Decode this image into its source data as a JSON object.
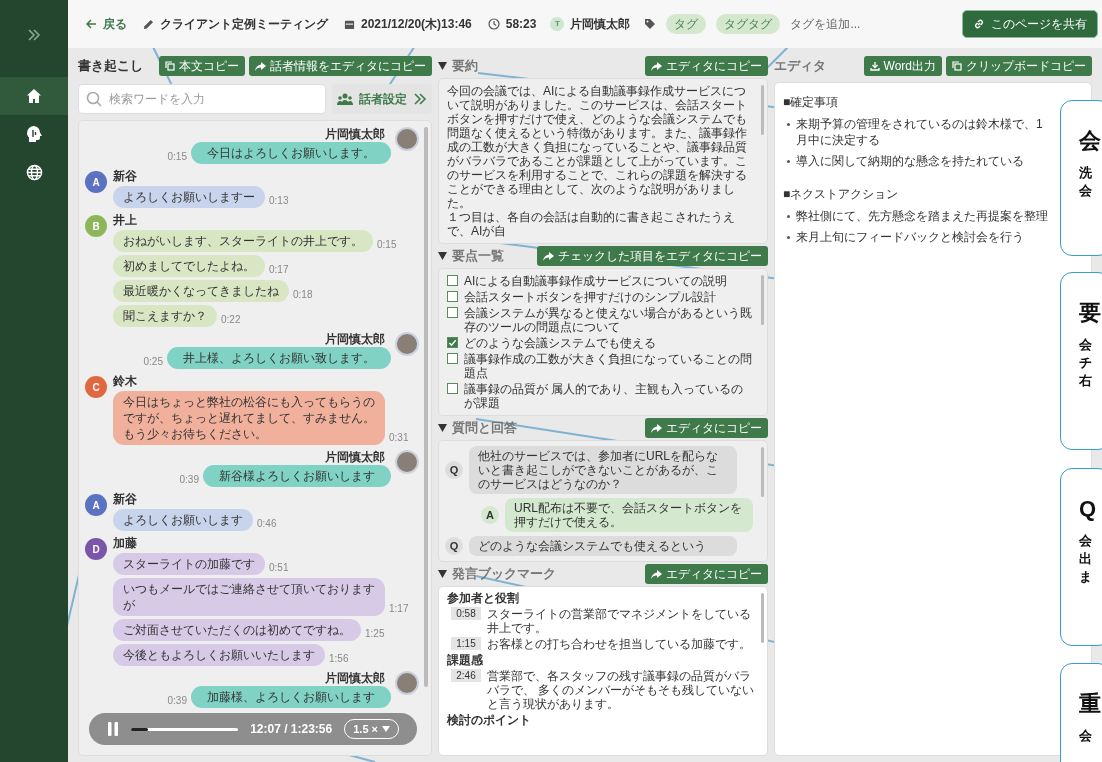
{
  "sidebar": {
    "nav_items": [
      {
        "selected": true
      },
      {
        "selected": false
      },
      {
        "selected": false
      }
    ]
  },
  "header": {
    "back": "戻る",
    "title": "クライアント定例ミーティング",
    "date": "2021/12/20(木)13:46",
    "duration": "58:23",
    "owner": {
      "initial": "T",
      "name": "片岡慎太郎"
    },
    "tags": [
      "タグ",
      "タグタグ"
    ],
    "add_tag": "タグを追加...",
    "share": "このページを共有"
  },
  "transcript": {
    "title": "書き起こし",
    "buttons": [
      "本文コピー",
      "話者情報をエディタにコピー"
    ],
    "search": {
      "placeholder": "検索ワードを入力"
    },
    "speaker_settings": "話者設定",
    "blocks": [
      {
        "kind": "self",
        "speaker": "片岡慎太郎",
        "messages": [
          {
            "text": "今日はよろしくお願いします。",
            "time": "0:15"
          }
        ]
      },
      {
        "kind": "other",
        "speaker": "新谷",
        "initial": "A",
        "color": "#5a72bf",
        "messages": [
          {
            "text": "よろしくお願いしますー",
            "time": "0:13"
          }
        ]
      },
      {
        "kind": "other",
        "speaker": "井上",
        "initial": "B",
        "color": "#8db65b",
        "messages": [
          {
            "text": "おねがいします、スターライトの井上です。",
            "time": "0:15"
          },
          {
            "text": "初めましてでしたよね。",
            "time": "0:17"
          },
          {
            "text": "最近暖かくなってきましたね",
            "time": "0:18"
          },
          {
            "text": "聞こえますか？",
            "time": "0:22"
          }
        ]
      },
      {
        "kind": "self",
        "speaker": "片岡慎太郎",
        "messages": [
          {
            "text": "井上様、よろしくお願い致します。",
            "time": "0:25"
          }
        ]
      },
      {
        "kind": "other",
        "speaker": "鈴木",
        "initial": "C",
        "color": "#e0673f",
        "messages": [
          {
            "text": "今日はちょっと弊社の松谷にも入ってもらうのですが、ちょっと遅れてまして、すみません。もう少々お待ちください。",
            "time": "0:31"
          }
        ]
      },
      {
        "kind": "self",
        "speaker": "片岡慎太郎",
        "messages": [
          {
            "text": "新谷様よろしくお願いします",
            "time": "0:39"
          }
        ]
      },
      {
        "kind": "other",
        "speaker": "新谷",
        "initial": "A",
        "color": "#5a72bf",
        "messages": [
          {
            "text": "よろしくお願いします",
            "time": "0:46"
          }
        ]
      },
      {
        "kind": "other",
        "speaker": "加藤",
        "initial": "D",
        "color": "#7a55a8",
        "messages": [
          {
            "text": "スターライトの加藤です",
            "time": "0:51"
          },
          {
            "text": "いつもメールではご連絡させて頂いておりますが",
            "time": "1:17"
          },
          {
            "text": "ご対面させていただくのは初めてですね。",
            "time": "1:25"
          },
          {
            "text": "今後ともよろしくお願いいたします",
            "time": "1:56"
          }
        ]
      },
      {
        "kind": "self",
        "speaker": "片岡慎太郎",
        "messages": [
          {
            "text": "加藤様、よろしくお願いします",
            "time": "0:39"
          }
        ]
      }
    ],
    "player": {
      "playing": true,
      "level": 0.16,
      "time": "12:07 / 1:23:56",
      "speed": "1.5 ×"
    }
  },
  "summary": {
    "title": "要約",
    "button": "エディタにコピー",
    "paragraphs": [
      "今回の会議では、AIによる自動議事録作成サービスについて説明がありました。このサービスは、会話スタートボタンを押すだけで使え、どのような会議システムでも問題なく使えるという特徴があります。また、議事録作成の工数が大きく負担になっていることや、議事録品質がバラバラであることが課題として上がっています。このサービスを利用することで、これらの課題を解決することができる理由として、次のような説明がありました。",
      "１つ目は、各自の会話は自動的に書き起こされたうえで、AIが自"
    ]
  },
  "key_points": {
    "title": "要点一覧",
    "button": "チェックした項目をエディタにコピー",
    "items": [
      {
        "text": "AIによる自動議事録作成サービスについての説明",
        "checked": false
      },
      {
        "text": "会話スタートボタンを押すだけのシンプル設計",
        "checked": false
      },
      {
        "text": "会議システムが異なると使えない場合があるという既存のツールの問題点について",
        "checked": false
      },
      {
        "text": "どのような会議システムでも使える",
        "checked": true
      },
      {
        "text": "議事録作成の工数が大きく負担になっていることの問題点",
        "checked": false
      },
      {
        "text": "議事録の品質が 属人的であり、主観も入っているのが課題",
        "checked": false
      }
    ]
  },
  "qa": {
    "title": "質問と回答",
    "button": "エディタにコピー",
    "items": [
      {
        "kind": "question",
        "mark": "Q",
        "text": "他社のサービスでは、参加者にURLを配らないと書き起こしができないことがあるが、このサービスはどうなのか？"
      },
      {
        "kind": "answer",
        "mark": "A",
        "text": "URL配布は不要で、会話スタートボタンを押すだけで使える。"
      },
      {
        "kind": "question",
        "mark": "Q",
        "text": "どのような会議システムでも使えるという"
      }
    ]
  },
  "bookmarks": {
    "title": "発言ブックマーク",
    "button": "エディタにコピー",
    "groups": [
      {
        "heading": "参加者と役割",
        "items": [
          {
            "time": "0:58",
            "text": "スターライトの営業部でマネジメントをしている井上です。"
          },
          {
            "time": "1:15",
            "text": "お客様との打ち合わせを担当している加藤です。"
          }
        ]
      },
      {
        "heading": "課題感",
        "items": [
          {
            "time": "2:46",
            "text": "営業部で、各スタッフの残す議事録の品質がバラバラで、 多くのメンバーがそもそも残していないと言う現状があります。"
          }
        ]
      },
      {
        "heading": "検討のポイント"
      }
    ]
  },
  "editor": {
    "title": "エディタ",
    "buttons": [
      "Word出力",
      "クリップボードコピー"
    ],
    "sections": [
      {
        "heading": "■確定事項",
        "bullets": [
          "来期予算の管理をされているのは鈴木様で、1月中に決定する",
          "導入に関して納期的な懸念を持たれている"
        ]
      },
      {
        "heading": "■ネクストアクション",
        "bullets": [
          "弊社側にて、先方懸念を踏まえた再提案を整理",
          "来月上旬にフィードバックと検討会を行う"
        ]
      }
    ]
  },
  "callouts": [
    {
      "title": "会",
      "lines": [
        "洗",
        "会"
      ]
    },
    {
      "title": "要",
      "lines": [
        "会",
        "チ",
        "右"
      ]
    },
    {
      "title": "Q",
      "lines": [
        "会",
        "出",
        "ま"
      ]
    },
    {
      "title": "重",
      "lines": [
        "会"
      ]
    }
  ]
}
